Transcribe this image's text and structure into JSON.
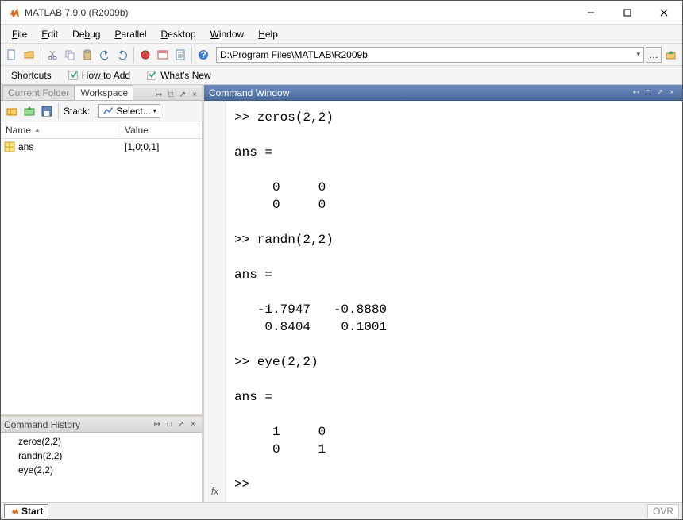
{
  "window": {
    "title": "MATLAB 7.9.0 (R2009b)"
  },
  "menu": {
    "file": "File",
    "edit": "Edit",
    "debug": "Debug",
    "parallel": "Parallel",
    "desktop": "Desktop",
    "window": "Window",
    "help": "Help"
  },
  "toolbar": {
    "path": "D:\\Program Files\\MATLAB\\R2009b"
  },
  "shortcuts": {
    "label": "Shortcuts",
    "howto": "How to Add",
    "whatsnew": "What's New"
  },
  "left_tabs": {
    "current_folder": "Current Folder",
    "workspace": "Workspace"
  },
  "workspace": {
    "stack_label": "Stack:",
    "select_label": "Select...",
    "col_name": "Name",
    "col_value": "Value",
    "rows": [
      {
        "name": "ans",
        "value": "[1,0;0,1]"
      }
    ]
  },
  "command_history": {
    "title": "Command History",
    "lines": [
      "zeros(2,2)",
      "randn(2,2)",
      "eye(2,2)"
    ]
  },
  "command_window": {
    "title": "Command Window",
    "text": ">> zeros(2,2)\n\nans =\n\n     0     0\n     0     0\n\n>> randn(2,2)\n\nans =\n\n   -1.7947   -0.8880\n    0.8404    0.1001\n\n>> eye(2,2)\n\nans =\n\n     1     0\n     0     1\n\n>> "
  },
  "statusbar": {
    "start": "Start",
    "ovr": "OVR"
  }
}
